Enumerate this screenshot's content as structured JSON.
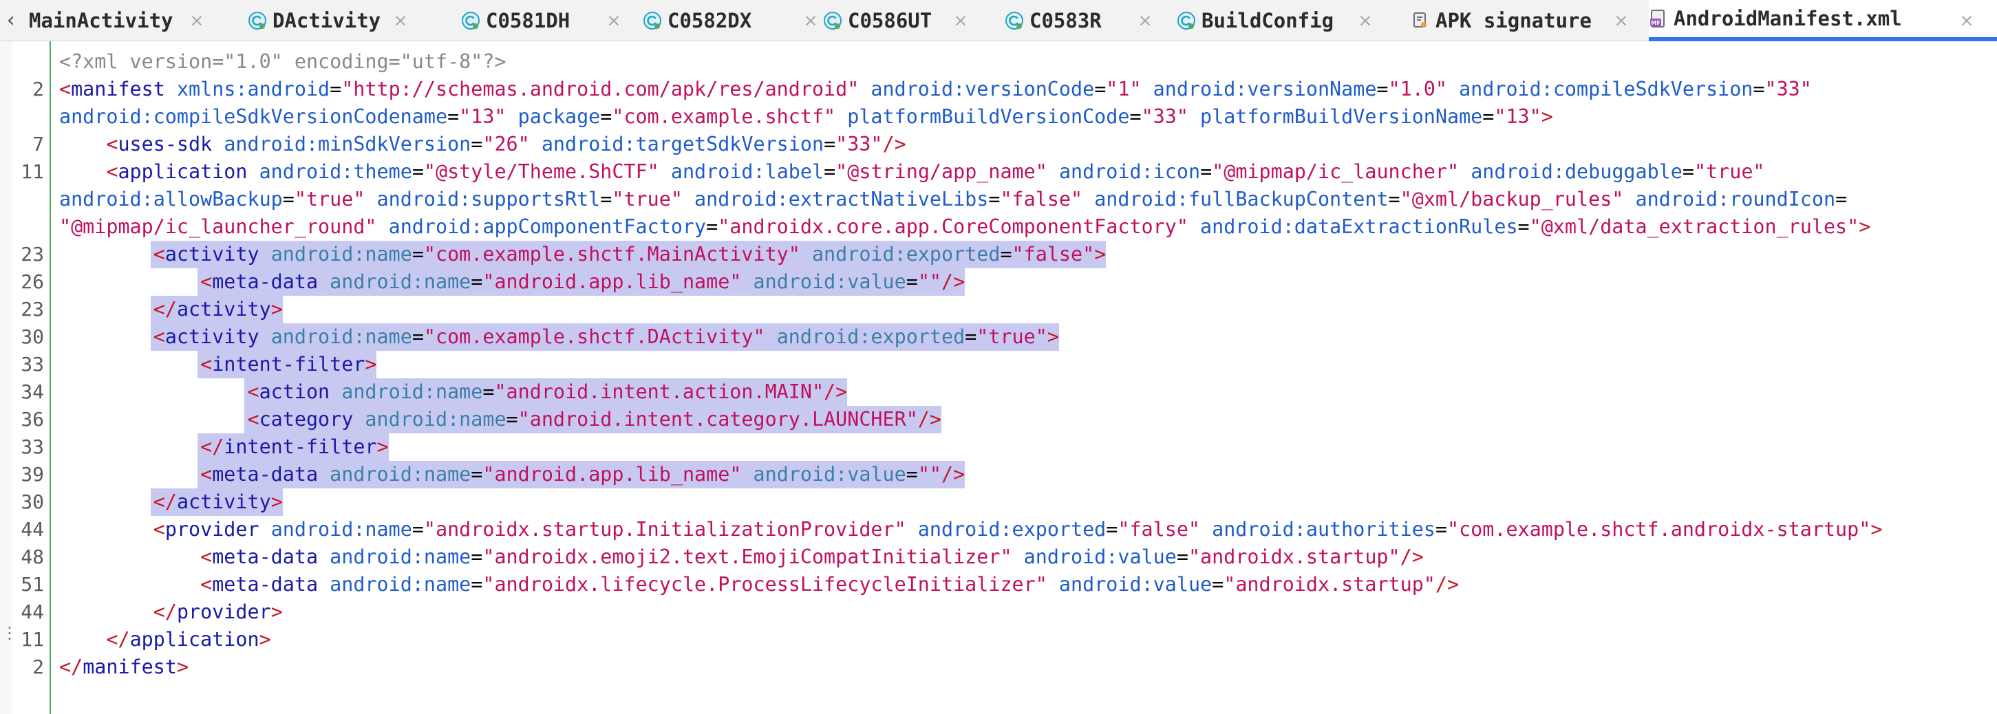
{
  "tabs": [
    {
      "label": "MainActivity",
      "icon": "none",
      "active": false
    },
    {
      "label": "DActivity",
      "icon": "class-icon",
      "active": false
    },
    {
      "label": "C0581DH",
      "icon": "class-icon",
      "active": false
    },
    {
      "label": "C0582DX",
      "icon": "class-icon",
      "active": false
    },
    {
      "label": "C0586UT",
      "icon": "class-icon",
      "active": false
    },
    {
      "label": "C0583R",
      "icon": "class-icon",
      "active": false
    },
    {
      "label": "BuildConfig",
      "icon": "class-icon",
      "active": false
    },
    {
      "label": "APK signature",
      "icon": "certificate-icon",
      "active": false
    },
    {
      "label": "AndroidManifest.xml",
      "icon": "manifest-icon",
      "active": true
    }
  ],
  "tab_close_glyph": "×",
  "tab_scroll_glyph": "‹",
  "colors": {
    "tag": "#1a1aa6",
    "bracket": "#c7172c",
    "attribute": "#1f5cc9",
    "value": "#c0115f",
    "selection": "#c8c9f0",
    "gutter_marker": "#59a869",
    "active_tab_underline": "#3574f0"
  },
  "editor": {
    "lines": [
      {
        "ln": "",
        "tokens": [
          [
            "decl",
            "<?xml version=\"1.0\" encoding=\"utf-8\"?>"
          ]
        ]
      },
      {
        "ln": "2",
        "tokens": [
          [
            "br",
            "<"
          ],
          [
            "tag",
            "manifest"
          ],
          [
            "t",
            " "
          ],
          [
            "attr",
            "xmlns:android"
          ],
          [
            "eq",
            "="
          ],
          [
            "val",
            "\"http://schemas.android.com/apk/res/android\""
          ],
          [
            "t",
            " "
          ],
          [
            "attr",
            "android:versionCode"
          ],
          [
            "eq",
            "="
          ],
          [
            "val",
            "\"1\""
          ],
          [
            "t",
            " "
          ],
          [
            "attr",
            "android:versionName"
          ],
          [
            "eq",
            "="
          ],
          [
            "val",
            "\"1.0\""
          ],
          [
            "t",
            " "
          ],
          [
            "attr",
            "android:compileSdkVersion"
          ],
          [
            "eq",
            "="
          ],
          [
            "val",
            "\"33\""
          ]
        ]
      },
      {
        "ln": "",
        "tokens": [
          [
            "attr",
            "android:compileSdkVersionCodename"
          ],
          [
            "eq",
            "="
          ],
          [
            "val",
            "\"13\""
          ],
          [
            "t",
            " "
          ],
          [
            "attr",
            "package"
          ],
          [
            "eq",
            "="
          ],
          [
            "val",
            "\"com.example.shctf\""
          ],
          [
            "t",
            " "
          ],
          [
            "attr",
            "platformBuildVersionCode"
          ],
          [
            "eq",
            "="
          ],
          [
            "val",
            "\"33\""
          ],
          [
            "t",
            " "
          ],
          [
            "attr",
            "platformBuildVersionName"
          ],
          [
            "eq",
            "="
          ],
          [
            "val",
            "\"13\""
          ],
          [
            "br",
            ">"
          ]
        ]
      },
      {
        "ln": "7",
        "tokens": [
          [
            "t",
            "    "
          ],
          [
            "br",
            "<"
          ],
          [
            "tag",
            "uses-sdk"
          ],
          [
            "t",
            " "
          ],
          [
            "attr",
            "android:minSdkVersion"
          ],
          [
            "eq",
            "="
          ],
          [
            "val",
            "\"26\""
          ],
          [
            "t",
            " "
          ],
          [
            "attr",
            "android:targetSdkVersion"
          ],
          [
            "eq",
            "="
          ],
          [
            "val",
            "\"33\""
          ],
          [
            "br",
            "/>"
          ]
        ]
      },
      {
        "ln": "11",
        "tokens": [
          [
            "t",
            "    "
          ],
          [
            "br",
            "<"
          ],
          [
            "tag",
            "application"
          ],
          [
            "t",
            " "
          ],
          [
            "attr",
            "android:theme"
          ],
          [
            "eq",
            "="
          ],
          [
            "val",
            "\"@style/Theme.ShCTF\""
          ],
          [
            "t",
            " "
          ],
          [
            "attr",
            "android:label"
          ],
          [
            "eq",
            "="
          ],
          [
            "val",
            "\"@string/app_name\""
          ],
          [
            "t",
            " "
          ],
          [
            "attr",
            "android:icon"
          ],
          [
            "eq",
            "="
          ],
          [
            "val",
            "\"@mipmap/ic_launcher\""
          ],
          [
            "t",
            " "
          ],
          [
            "attr",
            "android:debuggable"
          ],
          [
            "eq",
            "="
          ],
          [
            "val",
            "\"true\""
          ]
        ]
      },
      {
        "ln": "",
        "tokens": [
          [
            "attr",
            "android:allowBackup"
          ],
          [
            "eq",
            "="
          ],
          [
            "val",
            "\"true\""
          ],
          [
            "t",
            " "
          ],
          [
            "attr",
            "android:supportsRtl"
          ],
          [
            "eq",
            "="
          ],
          [
            "val",
            "\"true\""
          ],
          [
            "t",
            " "
          ],
          [
            "attr",
            "android:extractNativeLibs"
          ],
          [
            "eq",
            "="
          ],
          [
            "val",
            "\"false\""
          ],
          [
            "t",
            " "
          ],
          [
            "attr",
            "android:fullBackupContent"
          ],
          [
            "eq",
            "="
          ],
          [
            "val",
            "\"@xml/backup_rules\""
          ],
          [
            "t",
            " "
          ],
          [
            "attr",
            "android:roundIcon"
          ],
          [
            "eq",
            "="
          ]
        ]
      },
      {
        "ln": "",
        "tokens": [
          [
            "val",
            "\"@mipmap/ic_launcher_round\""
          ],
          [
            "t",
            " "
          ],
          [
            "attr",
            "android:appComponentFactory"
          ],
          [
            "eq",
            "="
          ],
          [
            "val",
            "\"androidx.core.app.CoreComponentFactory\""
          ],
          [
            "t",
            " "
          ],
          [
            "attr",
            "android:dataExtractionRules"
          ],
          [
            "eq",
            "="
          ],
          [
            "val",
            "\"@xml/data_extraction_rules\""
          ],
          [
            "br",
            ">"
          ]
        ]
      },
      {
        "ln": "23",
        "sel": true,
        "tokens": [
          [
            "t",
            "        "
          ],
          [
            "br",
            "<"
          ],
          [
            "tag",
            "activity"
          ],
          [
            "t",
            " "
          ],
          [
            "sattr",
            "android:name"
          ],
          [
            "eq",
            "="
          ],
          [
            "val",
            "\"com.example.shctf.MainActivity\""
          ],
          [
            "t",
            " "
          ],
          [
            "sattr",
            "android:exported"
          ],
          [
            "eq",
            "="
          ],
          [
            "val",
            "\"false\""
          ],
          [
            "br",
            ">"
          ]
        ]
      },
      {
        "ln": "26",
        "sel": true,
        "tokens": [
          [
            "t",
            "            "
          ],
          [
            "br",
            "<"
          ],
          [
            "tag",
            "meta-data"
          ],
          [
            "t",
            " "
          ],
          [
            "sattr",
            "android:name"
          ],
          [
            "eq",
            "="
          ],
          [
            "val",
            "\"android.app.lib_name\""
          ],
          [
            "t",
            " "
          ],
          [
            "sattr",
            "android:value"
          ],
          [
            "eq",
            "="
          ],
          [
            "val",
            "\"\""
          ],
          [
            "br",
            "/>"
          ]
        ]
      },
      {
        "ln": "23",
        "sel": true,
        "tokens": [
          [
            "t",
            "        "
          ],
          [
            "br",
            "</"
          ],
          [
            "tag",
            "activity"
          ],
          [
            "br",
            ">"
          ]
        ]
      },
      {
        "ln": "30",
        "sel": true,
        "tokens": [
          [
            "t",
            "        "
          ],
          [
            "br",
            "<"
          ],
          [
            "tag",
            "activity"
          ],
          [
            "t",
            " "
          ],
          [
            "sattr",
            "android:name"
          ],
          [
            "eq",
            "="
          ],
          [
            "val",
            "\"com.example.shctf.DActivity\""
          ],
          [
            "t",
            " "
          ],
          [
            "sattr",
            "android:exported"
          ],
          [
            "eq",
            "="
          ],
          [
            "val",
            "\"true\""
          ],
          [
            "br",
            ">"
          ]
        ]
      },
      {
        "ln": "33",
        "sel": true,
        "tokens": [
          [
            "t",
            "            "
          ],
          [
            "br",
            "<"
          ],
          [
            "tag",
            "intent-filter"
          ],
          [
            "br",
            ">"
          ]
        ]
      },
      {
        "ln": "34",
        "sel": true,
        "tokens": [
          [
            "t",
            "                "
          ],
          [
            "br",
            "<"
          ],
          [
            "tag",
            "action"
          ],
          [
            "t",
            " "
          ],
          [
            "sattr",
            "android:name"
          ],
          [
            "eq",
            "="
          ],
          [
            "val",
            "\"android.intent.action.MAIN\""
          ],
          [
            "br",
            "/>"
          ]
        ]
      },
      {
        "ln": "36",
        "sel": true,
        "tokens": [
          [
            "t",
            "                "
          ],
          [
            "br",
            "<"
          ],
          [
            "tag",
            "category"
          ],
          [
            "t",
            " "
          ],
          [
            "sattr",
            "android:name"
          ],
          [
            "eq",
            "="
          ],
          [
            "val",
            "\"android.intent.category.LAUNCHER\""
          ],
          [
            "br",
            "/>"
          ]
        ]
      },
      {
        "ln": "33",
        "sel": true,
        "tokens": [
          [
            "t",
            "            "
          ],
          [
            "br",
            "</"
          ],
          [
            "tag",
            "intent-filter"
          ],
          [
            "br",
            ">"
          ]
        ]
      },
      {
        "ln": "39",
        "sel": true,
        "tokens": [
          [
            "t",
            "            "
          ],
          [
            "br",
            "<"
          ],
          [
            "tag",
            "meta-data"
          ],
          [
            "t",
            " "
          ],
          [
            "sattr",
            "android:name"
          ],
          [
            "eq",
            "="
          ],
          [
            "val",
            "\"android.app.lib_name\""
          ],
          [
            "t",
            " "
          ],
          [
            "sattr",
            "android:value"
          ],
          [
            "eq",
            "="
          ],
          [
            "val",
            "\"\""
          ],
          [
            "br",
            "/>"
          ]
        ]
      },
      {
        "ln": "30",
        "sel": true,
        "tokens": [
          [
            "t",
            "        "
          ],
          [
            "br",
            "</"
          ],
          [
            "tag",
            "activity"
          ],
          [
            "br",
            ">"
          ]
        ]
      },
      {
        "ln": "44",
        "tokens": [
          [
            "t",
            "        "
          ],
          [
            "br",
            "<"
          ],
          [
            "tag",
            "provider"
          ],
          [
            "t",
            " "
          ],
          [
            "attr",
            "android:name"
          ],
          [
            "eq",
            "="
          ],
          [
            "val",
            "\"androidx.startup.InitializationProvider\""
          ],
          [
            "t",
            " "
          ],
          [
            "attr",
            "android:exported"
          ],
          [
            "eq",
            "="
          ],
          [
            "val",
            "\"false\""
          ],
          [
            "t",
            " "
          ],
          [
            "attr",
            "android:authorities"
          ],
          [
            "eq",
            "="
          ],
          [
            "val",
            "\"com.example.shctf.androidx-startup\""
          ],
          [
            "br",
            ">"
          ]
        ]
      },
      {
        "ln": "48",
        "tokens": [
          [
            "t",
            "            "
          ],
          [
            "br",
            "<"
          ],
          [
            "tag",
            "meta-data"
          ],
          [
            "t",
            " "
          ],
          [
            "attr",
            "android:name"
          ],
          [
            "eq",
            "="
          ],
          [
            "val",
            "\"androidx.emoji2.text.EmojiCompatInitializer\""
          ],
          [
            "t",
            " "
          ],
          [
            "attr",
            "android:value"
          ],
          [
            "eq",
            "="
          ],
          [
            "val",
            "\"androidx.startup\""
          ],
          [
            "br",
            "/>"
          ]
        ]
      },
      {
        "ln": "51",
        "tokens": [
          [
            "t",
            "            "
          ],
          [
            "br",
            "<"
          ],
          [
            "tag",
            "meta-data"
          ],
          [
            "t",
            " "
          ],
          [
            "attr",
            "android:name"
          ],
          [
            "eq",
            "="
          ],
          [
            "val",
            "\"androidx.lifecycle.ProcessLifecycleInitializer\""
          ],
          [
            "t",
            " "
          ],
          [
            "attr",
            "android:value"
          ],
          [
            "eq",
            "="
          ],
          [
            "val",
            "\"androidx.startup\""
          ],
          [
            "br",
            "/>"
          ]
        ]
      },
      {
        "ln": "44",
        "tokens": [
          [
            "t",
            "        "
          ],
          [
            "br",
            "</"
          ],
          [
            "tag",
            "provider"
          ],
          [
            "br",
            ">"
          ]
        ]
      },
      {
        "ln": "11",
        "tokens": [
          [
            "t",
            "    "
          ],
          [
            "br",
            "</"
          ],
          [
            "tag",
            "application"
          ],
          [
            "br",
            ">"
          ]
        ]
      },
      {
        "ln": "2",
        "tokens": [
          [
            "br",
            "</"
          ],
          [
            "tag",
            "manifest"
          ],
          [
            "br",
            ">"
          ]
        ]
      }
    ]
  }
}
